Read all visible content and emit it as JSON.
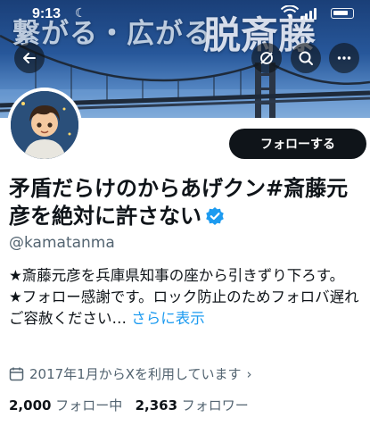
{
  "status_bar": {
    "time": "9:13"
  },
  "banner": {
    "text": "繋がる・広がる",
    "title": "脱斎藤"
  },
  "profile": {
    "display_name": "矛盾だらけのからあげクン#斎藤元彦を絶対に許さない",
    "handle": "@kamatanma",
    "bio_line1": "★斎藤元彦を兵庫県知事の座から引きずり下ろす。",
    "bio_line2": "★フォロー感謝です。ロック防止のためフォロバ遅れご容赦ください…",
    "show_more": "さらに表示",
    "joined": "2017年1月からXを利用しています",
    "following_count": "2,000",
    "following_label": "フォロー中",
    "followers_count": "2,363",
    "followers_label": "フォロワー"
  },
  "actions": {
    "follow_label": "フォローする"
  },
  "colors": {
    "accent": "#1d9bf0",
    "text": "#0f1419",
    "secondary": "#536471",
    "button_bg": "#0f1419"
  }
}
